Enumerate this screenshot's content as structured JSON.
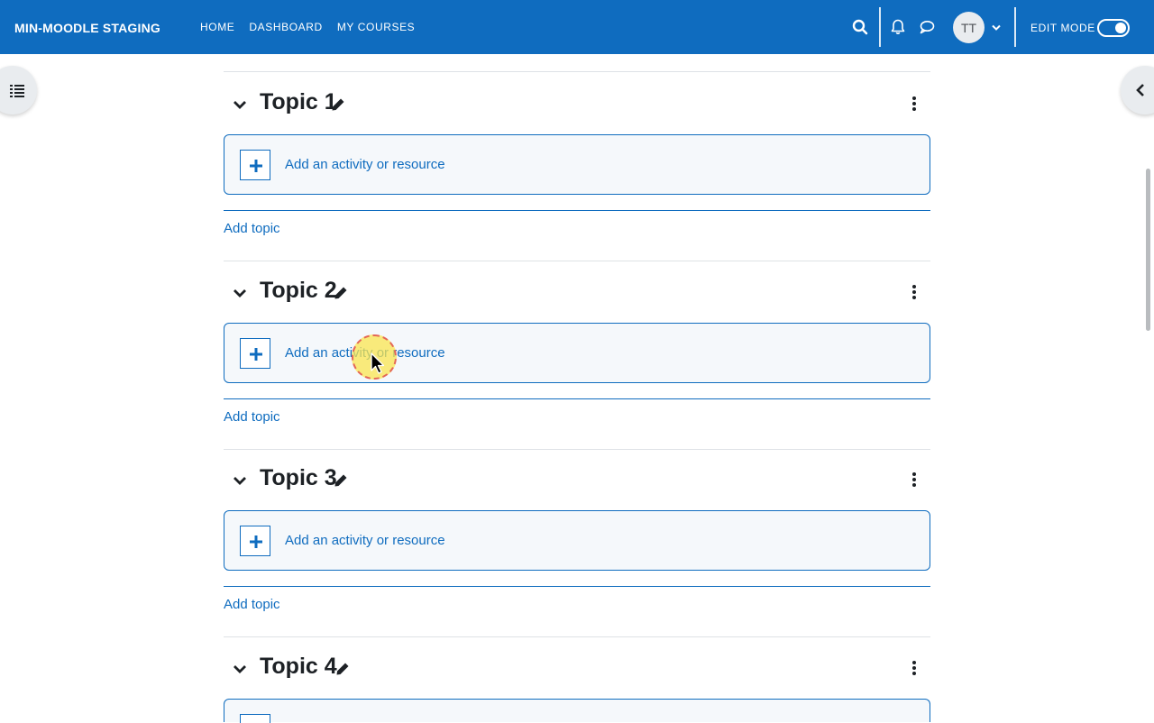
{
  "navbar": {
    "brand": "MIN-MOODLE STAGING",
    "links": [
      "HOME",
      "DASHBOARD",
      "MY COURSES"
    ],
    "avatar_initials": "TT",
    "edit_mode_label": "EDIT MODE",
    "edit_mode_on": true,
    "icons": [
      "search-icon",
      "bell-icon",
      "chat-bubble-icon",
      "chevron-down-icon"
    ],
    "colors": {
      "bar": "#0f6cbf",
      "text": "#ffffff"
    }
  },
  "drawers": {
    "left_icon": "course-index-icon",
    "right_icon": "chevron-left-icon"
  },
  "sections": [
    {
      "title": "Topic 1",
      "activity_label": "Add an activity or resource",
      "add_topic": "Add topic"
    },
    {
      "title": "Topic 2",
      "activity_label": "Add an activity or resource",
      "add_topic": "Add topic"
    },
    {
      "title": "Topic 3",
      "activity_label": "Add an activity or resource",
      "add_topic": "Add topic"
    },
    {
      "title": "Topic 4",
      "activity_label": "",
      "add_topic": ""
    }
  ],
  "colors": {
    "link": "#0f6cbf",
    "box_bg": "#f5f8fb"
  }
}
